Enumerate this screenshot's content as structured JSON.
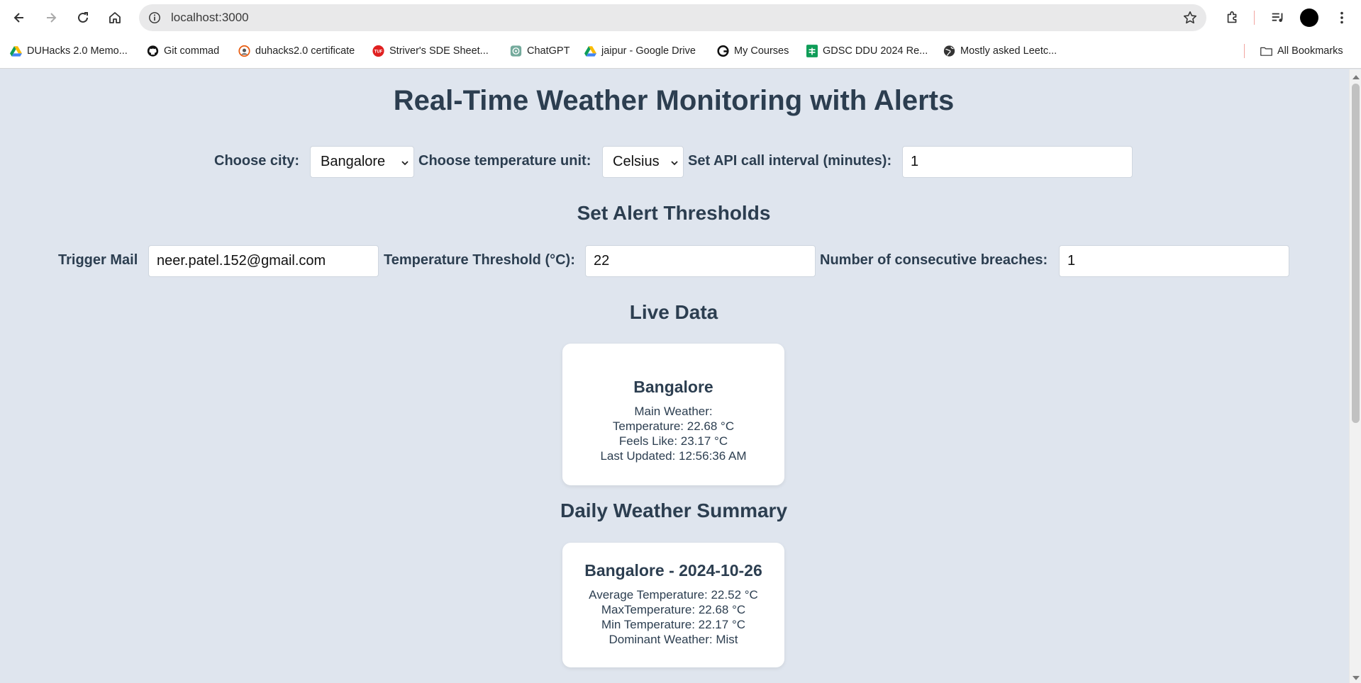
{
  "browser": {
    "url": "localhost:3000",
    "bookmarks": [
      {
        "label": "DUHacks 2.0 Memo...",
        "icon": "google-drive-icon"
      },
      {
        "label": "Git commad",
        "icon": "github-icon"
      },
      {
        "label": "duhacks2.0 certificate",
        "icon": "certificate-icon"
      },
      {
        "label": "Striver's SDE Sheet...",
        "icon": "tuf-icon"
      },
      {
        "label": "ChatGPT",
        "icon": "chatgpt-icon"
      },
      {
        "label": "jaipur - Google Drive",
        "icon": "google-drive-icon"
      },
      {
        "label": "My Courses",
        "icon": "course-icon"
      },
      {
        "label": "GDSC DDU 2024 Re...",
        "icon": "sheets-icon"
      },
      {
        "label": "Mostly asked Leetc...",
        "icon": "globe-icon"
      }
    ],
    "all_bookmarks": "All Bookmarks"
  },
  "page": {
    "title": "Real-Time Weather Monitoring with Alerts",
    "controls": {
      "city_label": "Choose city:",
      "city_value": "Bangalore",
      "unit_label": "Choose temperature unit:",
      "unit_value": "Celsius",
      "interval_label": "Set API call interval (minutes):",
      "interval_value": "1"
    },
    "alerts": {
      "heading": "Set Alert Thresholds",
      "mail_label": "Trigger Mail",
      "mail_value": "neer.patel.152@gmail.com",
      "temp_label": "Temperature Threshold (°C):",
      "temp_value": "22",
      "breaches_label": "Number of consecutive breaches:",
      "breaches_value": "1"
    },
    "live": {
      "heading": "Live Data",
      "city": "Bangalore",
      "main_weather": "Main Weather:",
      "temperature": "Temperature: 22.68 °C",
      "feels_like": "Feels Like: 23.17 °C",
      "last_updated": "Last Updated: 12:56:36 AM"
    },
    "summary": {
      "heading": "Daily Weather Summary",
      "title": "Bangalore - 2024-10-26",
      "avg": "Average Temperature: 22.52 °C",
      "max": "MaxTemperature: 22.68 °C",
      "min": "Min Temperature: 22.17 °C",
      "dominant": "Dominant Weather: Mist"
    }
  }
}
